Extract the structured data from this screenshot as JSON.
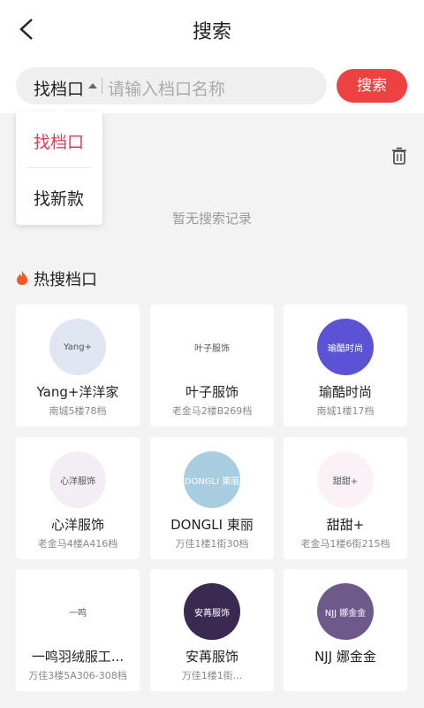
{
  "header": {
    "title": "搜索"
  },
  "search": {
    "type_label": "找档口",
    "placeholder": "请输入档口名称",
    "button_label": "搜索"
  },
  "dropdown": {
    "items": [
      {
        "label": "找档口",
        "active": true
      },
      {
        "label": "找新款",
        "active": false
      }
    ]
  },
  "history": {
    "empty_text": "暂无搜索记录"
  },
  "hot": {
    "title": "热搜档口",
    "shops": [
      {
        "name": "Yang+洋洋家",
        "location": "南城5楼78档",
        "logo_text": "Yang+",
        "logo_color": "#dfe6f2"
      },
      {
        "name": "叶子服饰",
        "location": "老金马2楼B269档",
        "logo_text": "叶子服饰",
        "logo_color": "#ffffff"
      },
      {
        "name": "瑜酷时尚",
        "location": "南城1楼17档",
        "logo_text": "瑜酷时尚",
        "logo_color": "#5c52d6"
      },
      {
        "name": "心洋服饰",
        "location": "老金马4楼A416档",
        "logo_text": "心洋服饰",
        "logo_color": "#f3eef6"
      },
      {
        "name": "DONGLI 東丽",
        "location": "万佳1楼1街30档",
        "logo_text": "DONGLI 東丽",
        "logo_color": "#a9cde0"
      },
      {
        "name": "甜甜+",
        "location": "老金马1楼6街215档",
        "logo_text": "甜甜+",
        "logo_color": "#faf2f7"
      },
      {
        "name": "一鸣羽绒服工...",
        "location": "万佳3楼5A306-308档",
        "logo_text": "一鸣",
        "logo_color": "#ffffff"
      },
      {
        "name": "安苒服饰",
        "location": "万佳1楼1街...",
        "logo_text": "安苒服饰",
        "logo_color": "#3a2a52"
      },
      {
        "name": "NJJ 娜金金",
        "location": "",
        "logo_text": "NJJ 娜金金",
        "logo_color": "#6e5a8a"
      }
    ]
  },
  "colors": {
    "accent": "#ee4242",
    "active_text": "#e23b4d"
  }
}
